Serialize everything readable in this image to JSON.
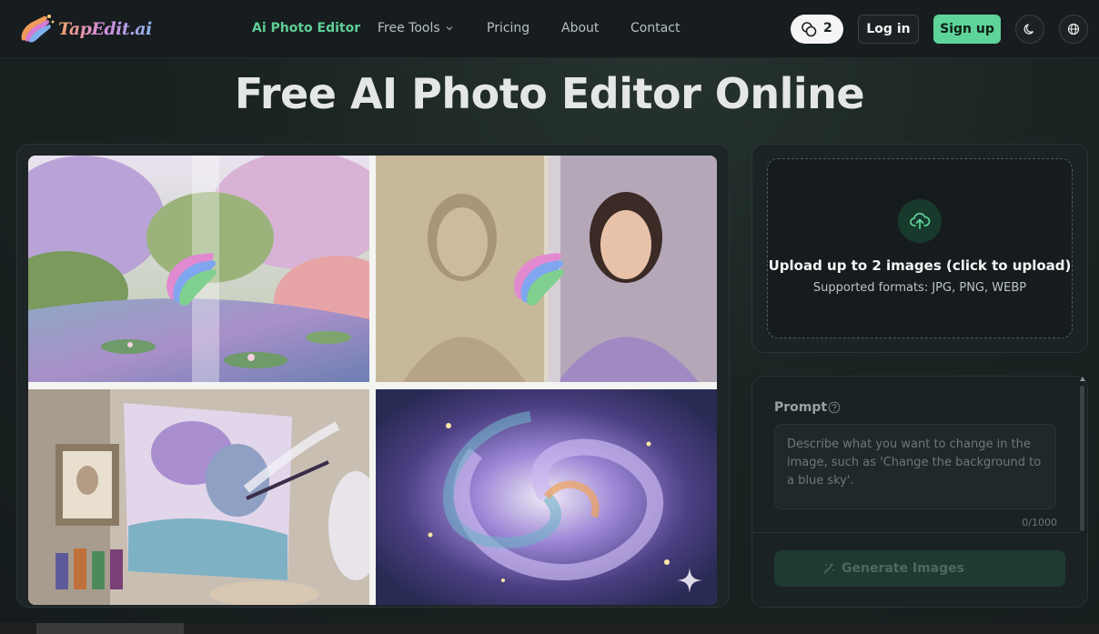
{
  "header": {
    "logo_text": "TapEdit.ai",
    "nav": [
      {
        "label": "Ai Photo Editor",
        "active": true
      },
      {
        "label": "Free Tools",
        "has_dropdown": true
      },
      {
        "label": "Pricing"
      },
      {
        "label": "About"
      },
      {
        "label": "Contact"
      }
    ],
    "credits": "2",
    "login_label": "Log in",
    "signup_label": "Sign up",
    "theme_icon": "moon-icon",
    "language_icon": "globe-icon"
  },
  "main": {
    "title": "Free AI Photo Editor Online",
    "gallery": [
      {
        "name": "garden-pond-painting",
        "icon": "paint-stroke-icon"
      },
      {
        "name": "portrait-restoration",
        "icon": "paint-stroke-icon"
      },
      {
        "name": "easel-painting"
      },
      {
        "name": "purple-swirl-abstract",
        "icon": "sparkle-icon"
      }
    ]
  },
  "upload": {
    "title": "Upload up to 2 images (click to upload)",
    "formats": "Supported formats: JPG, PNG, WEBP",
    "icon": "cloud-upload-icon"
  },
  "prompt": {
    "label": "Prompt",
    "placeholder": "Describe what you want to change in the image, such as 'Change the background to a blue sky'.",
    "value": "",
    "count": "0/1000",
    "generate_label": "Generate Images"
  },
  "colors": {
    "accent": "#5fd49a",
    "active_nav": "#5fcf96",
    "background": "#161b1d"
  }
}
